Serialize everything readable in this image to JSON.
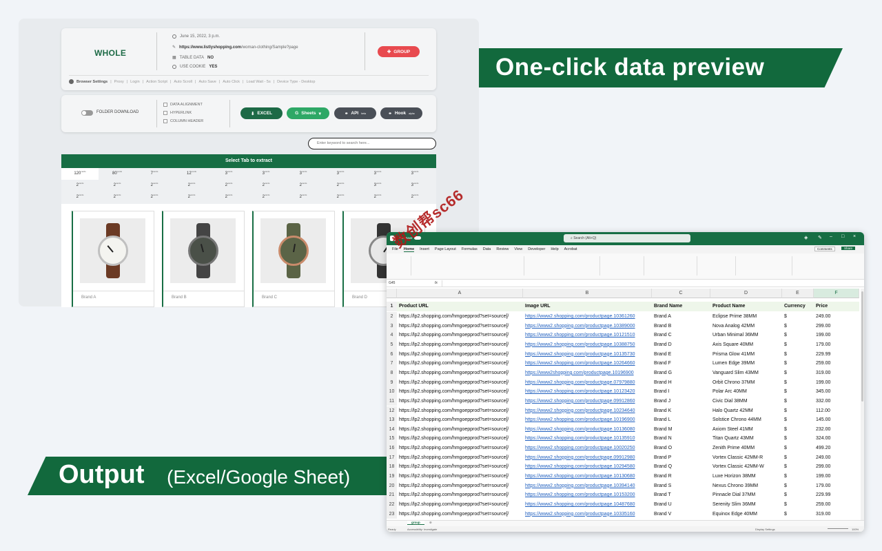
{
  "extractor": {
    "mode": "WHOLE",
    "date": "June 15, 2022, 3 p.m.",
    "url_bold": "https://www.listlyshopping.com",
    "url_rest": "/woman-clothing/Sample?page",
    "table_data_label": "TABLE DATA",
    "table_data_value": "NO",
    "use_cookie_label": "USE COOKIE",
    "use_cookie_value": "YES",
    "group_button": "GROUP",
    "settings": [
      "Browser Settings",
      "Proxy",
      "Login",
      "Action Script",
      "Auto Scroll",
      "Auto Save",
      "Auto Click",
      "Load Wait - 5s",
      "Device Type - Desktop"
    ],
    "folder_download": "FOLDER DOWNLOAD",
    "checkboxes": [
      "DATA ALIGNMENT",
      "HYPERLINK",
      "COLUMN HEADER"
    ],
    "excel_button": "EXCEL",
    "sheets_button": "Sheets",
    "api_button": "API",
    "api_sup": "beta",
    "hook_button": "Hook",
    "hook_sup": "alpha",
    "search_placeholder": "Enter keyword to search here...",
    "tab_title": "Select Tab to extract",
    "tab_counts": [
      [
        "120",
        "80",
        "7",
        "12",
        "3",
        "3",
        "3",
        "3",
        "3",
        "3"
      ],
      [
        "2",
        "2",
        "2",
        "2",
        "2",
        "2",
        "2",
        "2",
        "3",
        "3"
      ],
      [
        "2",
        "2",
        "2",
        "2",
        "2",
        "2",
        "2",
        "2",
        "2",
        "2"
      ]
    ],
    "count_unit": "cards",
    "products": [
      "Brand A",
      "Brand B",
      "Brand C",
      "Brand D"
    ]
  },
  "banners": {
    "top": "One-click data preview",
    "bottom_bold": "Output",
    "bottom_light": "(Excel/Google Sheet)"
  },
  "watermark": "数创帮sc66",
  "excel": {
    "autosave": "AutoSave",
    "search": "Search (Alt+Q)",
    "comments": "Comments",
    "share": "Share",
    "menu": [
      "File",
      "Home",
      "Insert",
      "Page Layout",
      "Formulas",
      "Data",
      "Review",
      "View",
      "Developer",
      "Help",
      "Acrobat"
    ],
    "cell_ref": "G45",
    "fx": "fx",
    "columns": [
      "A",
      "B",
      "C",
      "D",
      "E",
      "F"
    ],
    "headers": [
      "Product URL",
      "Image URL",
      "Brand Name",
      "Product Name",
      "Currency",
      "Price"
    ],
    "rows": [
      [
        "https://lp2.shopping.com/hmgoepprod?set=source[/",
        "https://www2.shopping.com/productpage.10361260",
        "Brand A",
        "Eclipse Prime 38MM",
        "$",
        "249.00"
      ],
      [
        "https://lp2.shopping.com/hmgoepprod?set=source[/",
        "https://www2.shopping.com/productpage.10389000",
        "Brand B",
        "Nova Analog 42MM",
        "$",
        "299.00"
      ],
      [
        "https://lp2.shopping.com/hmgoepprod?set=source[/",
        "https://www2.shopping.com/productpage.10121510",
        "Brand C",
        "Urban Minimal 36MM",
        "$",
        "199.00"
      ],
      [
        "https://lp2.shopping.com/hmgoepprod?set=source[/",
        "https://www2.shopping.com/productpage.10388750",
        "Brand D",
        "Axis Square 40MM",
        "$",
        "179.00"
      ],
      [
        "https://lp2.shopping.com/hmgoepprod?set=source[/",
        "https://www2.shopping.com/productpage.10135730",
        "Brand E",
        "Prisma Glow 41MM",
        "$",
        "229.99"
      ],
      [
        "https://lp2.shopping.com/hmgoepprod?set=source[/",
        "https://www2.shopping.com/productpage.10264660",
        "Brand F",
        "Lumen Edge 39MM",
        "$",
        "259.00"
      ],
      [
        "https://lp2.shopping.com/hmgoepprod?set=source[/",
        "https://www2shopping.com/productpage.10196900",
        "Brand G",
        "Vanguard Slim 43MM",
        "$",
        "319.00"
      ],
      [
        "https://lp2.shopping.com/hmgoepprod?set=source[/",
        "https://www2.shopping.com/productpage.07979880",
        "Brand H",
        "Orbit Chrono 37MM",
        "$",
        "199.00"
      ],
      [
        "https://lp2.shopping.com/hmgoepprod?set=source[/",
        "https://www2.shopping.com/productpage.10123420",
        "Brand I",
        "Polar Arc 40MM",
        "$",
        "345.00"
      ],
      [
        "https://lp2.shopping.com/hmgoepprod?set=source[/",
        "https://www2.shopping.com/productpage.09912860",
        "Brand J",
        "Civic Dial 38MM",
        "$",
        "332.00"
      ],
      [
        "https://lp2.shopping.com/hmgoepprod?set=source[/",
        "https://www2.shopping.com/productpage.10234640",
        "Brand K",
        "Halo Quartz 42MM",
        "$",
        "112.00"
      ],
      [
        "https://lp2.shopping.com/hmgoepprod?set=source[/",
        "https://www2.shopping.com/productpage.10196900",
        "Brand L",
        "Solstice Chrono 44MM",
        "$",
        "145.00"
      ],
      [
        "https://lp2.shopping.com/hmgoepprod?set=source[/",
        "https://www2.shopping.com/productpage.10136080",
        "Brand M",
        "Axiom Steel 41MM",
        "$",
        "232.00"
      ],
      [
        "https://lp2.shopping.com/hmgoepprod?set=source[/",
        "https://www2.shopping.com/productpage.10135910",
        "Brand N",
        "Titan Quartz 43MM",
        "$",
        "324.00"
      ],
      [
        "https://lp2.shopping.com/hmgoepprod?set=source[/",
        "https://www2.shopping.com/productpage.10020250",
        "Brand O",
        "Zenith Prime 40MM",
        "$",
        "499.20"
      ],
      [
        "https://lp2.shopping.com/hmgoepprod?set=source[/",
        "https://www2.shopping.com/productpage.09912980",
        "Brand P",
        "Vortex Classic 42MM-R",
        "$",
        "249.00"
      ],
      [
        "https://lp2.shopping.com/hmgoepprod?set=source[/",
        "https://www2.shopping.com/productpage.10294580",
        "Brand Q",
        "Vortex Classic 42MM-W",
        "$",
        "299.00"
      ],
      [
        "https://lp2.shopping.com/hmgoepprod?set=source[/",
        "https://www2.shopping.com/productpage.10130680",
        "Brand R",
        "Luxe Horizon 38MM",
        "$",
        "199.00"
      ],
      [
        "https://lp2.shopping.com/hmgoepprod?set=source[/",
        "https://www2.shopping.com/productpage.10394140",
        "Brand S",
        "Nexus Chrono 39MM",
        "$",
        "179.00"
      ],
      [
        "https://lp2.shopping.com/hmgoepprod?set=source[/",
        "https://www2.shopping.com/productpage.10153200",
        "Brand T",
        "Pinnacle Dial 37MM",
        "$",
        "229.99"
      ],
      [
        "https://lp2.shopping.com/hmgoepprod?set=source[/",
        "https://www2.shopping.com/productpage.10487680",
        "Brand U",
        "Serenity Slim 36MM",
        "$",
        "259.00"
      ],
      [
        "https://lp2.shopping.com/hmgoepprod?set=source[/",
        "https://www2.shopping.com/productpage.10335160",
        "Brand V",
        "Equinox Edge 40MM",
        "$",
        "319.00"
      ]
    ],
    "sheet_tab": "group",
    "status_ready": "Ready",
    "status_access": "Accessibility: Investigate",
    "display_settings": "Display Settings",
    "zoom": "100%"
  },
  "colors": {
    "brand_green": "#176e44",
    "banner_green": "#12693d",
    "group_red": "#e84a4f",
    "link_blue": "#1f5fbf"
  }
}
